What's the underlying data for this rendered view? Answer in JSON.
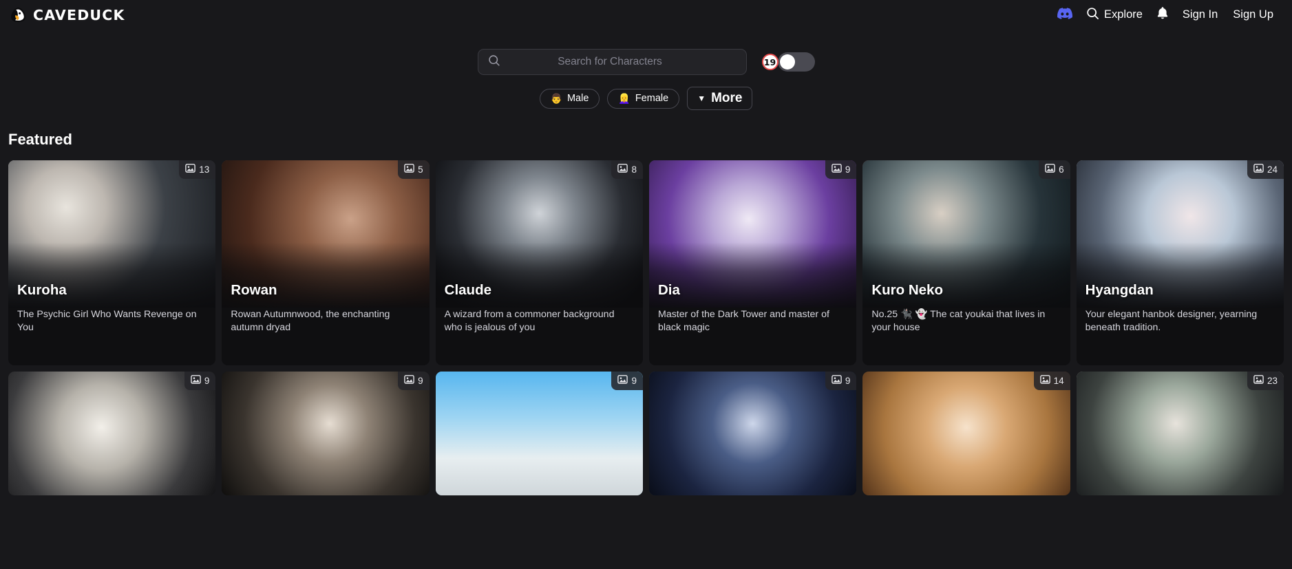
{
  "header": {
    "logo_text": "CAVEDUCK",
    "logo_icon": "duck-logo-icon",
    "discord_icon": "discord-icon",
    "search_icon": "search-icon",
    "explore_label": "Explore",
    "bell_icon": "bell-icon",
    "sign_in_label": "Sign In",
    "sign_up_label": "Sign Up"
  },
  "search": {
    "icon": "search-icon",
    "placeholder": "Search for Characters",
    "value": "",
    "age_badge": "19",
    "toggle_state": "off"
  },
  "filters": {
    "items": [
      {
        "emoji": "👨",
        "label": "Male",
        "name": "filter-male"
      },
      {
        "emoji": "👱‍♀️",
        "label": "Female",
        "name": "filter-female"
      }
    ],
    "more_label": "More",
    "more_caret": "▼"
  },
  "featured": {
    "title": "Featured",
    "row1": [
      {
        "name": "Kuroha",
        "desc": "The Psychic Girl Who Wants Revenge on You",
        "images": "13",
        "art": "art1"
      },
      {
        "name": "Rowan",
        "desc": "Rowan Autumnwood, the enchanting autumn dryad",
        "images": "5",
        "art": "art2"
      },
      {
        "name": "Claude",
        "desc": "A wizard from a commoner background who is jealous of you",
        "images": "8",
        "art": "art3"
      },
      {
        "name": "Dia",
        "desc": "Master of the Dark Tower and master of black magic",
        "images": "9",
        "art": "art4"
      },
      {
        "name": "Kuro Neko",
        "desc": "No.25 🐈‍⬛ 👻 The cat youkai that lives in your house",
        "images": "6",
        "art": "art5"
      },
      {
        "name": "Hyangdan",
        "desc": "Your elegant hanbok designer, yearning beneath tradition.",
        "images": "24",
        "art": "art6"
      }
    ],
    "row2": [
      {
        "images": "9",
        "art": "art7"
      },
      {
        "images": "9",
        "art": "art8"
      },
      {
        "images": "9",
        "art": "art9"
      },
      {
        "images": "9",
        "art": "art10"
      },
      {
        "images": "14",
        "art": "art11"
      },
      {
        "images": "23",
        "art": "art12"
      }
    ]
  },
  "colors": {
    "background": "#18181b",
    "card_background": "#0f0f11",
    "accent_orange": "#f5a623",
    "discord_purple": "#5865f2",
    "badge_red": "#e94b4b",
    "text_primary": "#ffffff",
    "text_secondary": "#d6d6dd",
    "placeholder": "#83838f"
  }
}
